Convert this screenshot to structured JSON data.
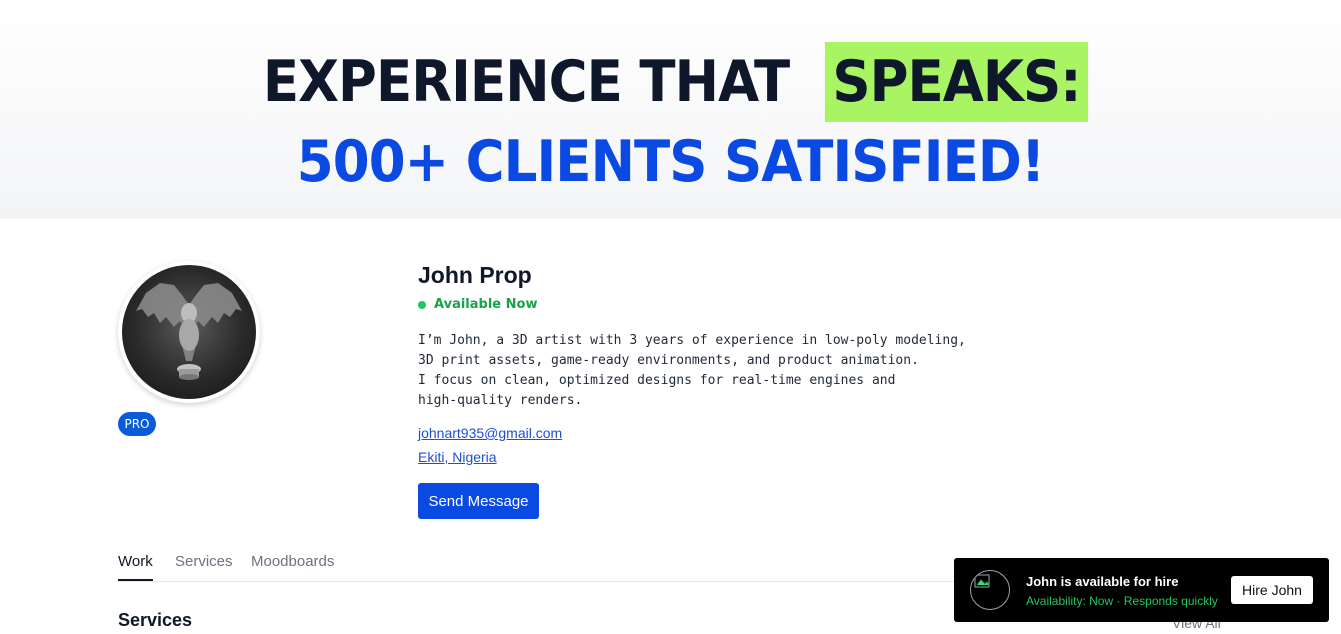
{
  "hero": {
    "line1_prefix": "EXPERIENCE THAT",
    "line1_highlight": "SPEAKS:",
    "line2": "500+ CLIENTS SATISFIED!",
    "highlight_color": "#a9f462",
    "accent_color": "#0b4ae2"
  },
  "profile": {
    "name": "John Prop",
    "availability": "Available Now",
    "bio": "I’m John, a 3D artist with 3 years of experience in low-poly modeling,\n3D print assets, game-ready environments, and product animation.\nI focus on clean, optimized designs for real-time engines and\nhigh-quality renders.",
    "email": "johnart935@gmail.com",
    "location": "Ekiti, Nigeria",
    "badge": "PRO",
    "avatar_icon": "gargoyle-statue-image",
    "send_message_label": "Send Message"
  },
  "tabs": [
    {
      "label": "Work",
      "active": true
    },
    {
      "label": "Services",
      "active": false
    },
    {
      "label": "Moodboards",
      "active": false
    }
  ],
  "services_section": {
    "title": "Services",
    "view_all": "View All"
  },
  "hire_card": {
    "title": "John is available for hire",
    "subtitle": "Availability: Now · Responds quickly",
    "button_label": "Hire John",
    "avatar_icon": "broken-image-icon"
  }
}
